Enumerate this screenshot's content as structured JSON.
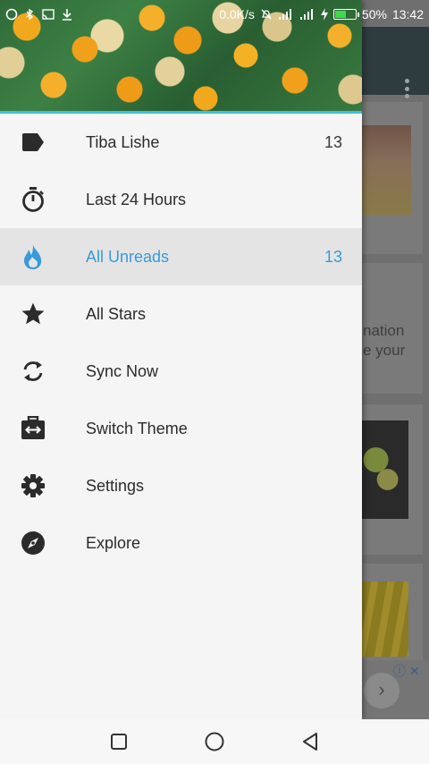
{
  "status_bar": {
    "net_speed": "0.0K/s",
    "battery": "50%",
    "battery_level": 0.5,
    "time": "13:42",
    "icons": [
      "circle-notification-icon",
      "bluetooth-icon",
      "cast-icon",
      "download-icon",
      "mute-icon",
      "signal-icon",
      "signal-icon",
      "charging-icon"
    ]
  },
  "drawer": {
    "menu": [
      {
        "id": "tiba-lishe",
        "label": "Tiba Lishe",
        "count": "13",
        "icon": "tag-icon",
        "active": false
      },
      {
        "id": "last-24-hours",
        "label": "Last 24 Hours",
        "count": "",
        "icon": "stopwatch-icon",
        "active": false
      },
      {
        "id": "all-unreads",
        "label": "All Unreads",
        "count": "13",
        "icon": "flame-icon",
        "active": true
      },
      {
        "id": "all-stars",
        "label": "All Stars",
        "count": "",
        "icon": "star-icon",
        "active": false
      },
      {
        "id": "sync-now",
        "label": "Sync Now",
        "count": "",
        "icon": "sync-icon",
        "active": false
      },
      {
        "id": "switch-theme",
        "label": "Switch Theme",
        "count": "",
        "icon": "switch-theme-icon",
        "active": false
      },
      {
        "id": "settings",
        "label": "Settings",
        "count": "",
        "icon": "gear-icon",
        "active": false
      },
      {
        "id": "explore",
        "label": "Explore",
        "count": "",
        "icon": "compass-icon",
        "active": false
      }
    ]
  },
  "background": {
    "text_line1": "nation",
    "text_line2": "e your"
  },
  "colors": {
    "accent": "#3a9ad9",
    "header_stripe": "#3ec1d6",
    "icon": "#2b2b2b"
  },
  "navbar": {
    "buttons": [
      "recents-square-icon",
      "home-circle-icon",
      "back-triangle-icon"
    ]
  }
}
